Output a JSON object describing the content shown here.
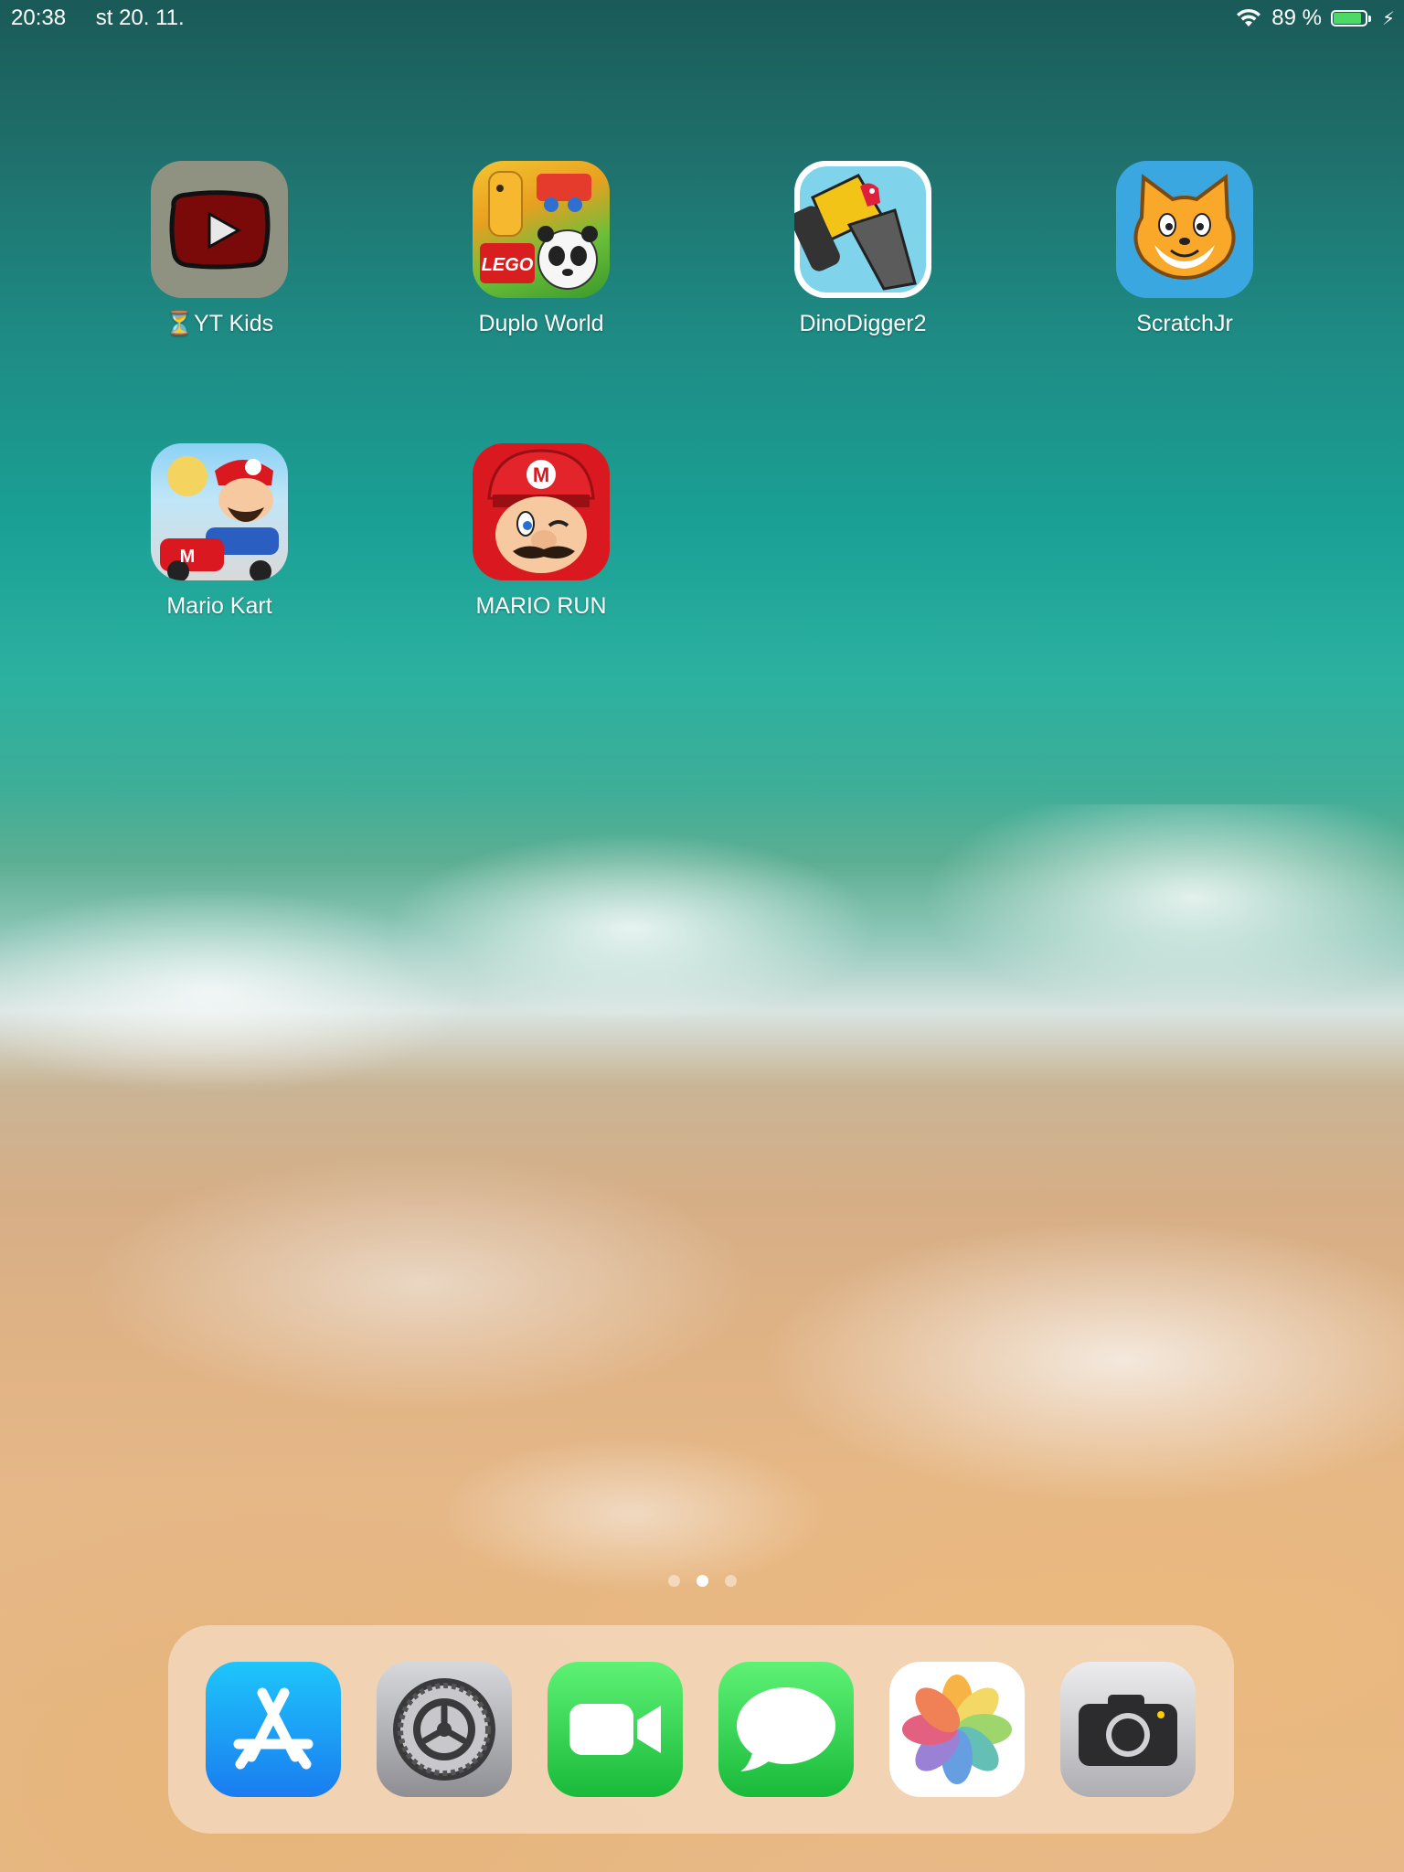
{
  "status_bar": {
    "time": "20:38",
    "date": "st 20. 11.",
    "battery_percent": "89 %",
    "battery_level": 0.89
  },
  "home_apps": [
    {
      "label": "⏳YT Kids",
      "icon": "youtube-kids-icon"
    },
    {
      "label": "Duplo World",
      "icon": "duplo-world-icon"
    },
    {
      "label": "DinoDigger2",
      "icon": "dino-digger-icon"
    },
    {
      "label": "ScratchJr",
      "icon": "scratchjr-cat-icon"
    },
    {
      "label": "Mario Kart",
      "icon": "mario-kart-icon"
    },
    {
      "label": "MARIO RUN",
      "icon": "mario-run-icon"
    }
  ],
  "page_indicator": {
    "pages": 3,
    "current": 2
  },
  "dock_apps": [
    {
      "icon": "app-store-icon"
    },
    {
      "icon": "settings-gear-icon"
    },
    {
      "icon": "facetime-icon"
    },
    {
      "icon": "messages-icon"
    },
    {
      "icon": "photos-icon"
    },
    {
      "icon": "camera-icon"
    }
  ],
  "colors": {
    "battery_green": "#4cd964",
    "app_store_blue": "#1a8cf5",
    "facetime_green": "#2fc84a",
    "mario_red": "#d9191f",
    "scratch_blue": "#3ba7e0"
  }
}
